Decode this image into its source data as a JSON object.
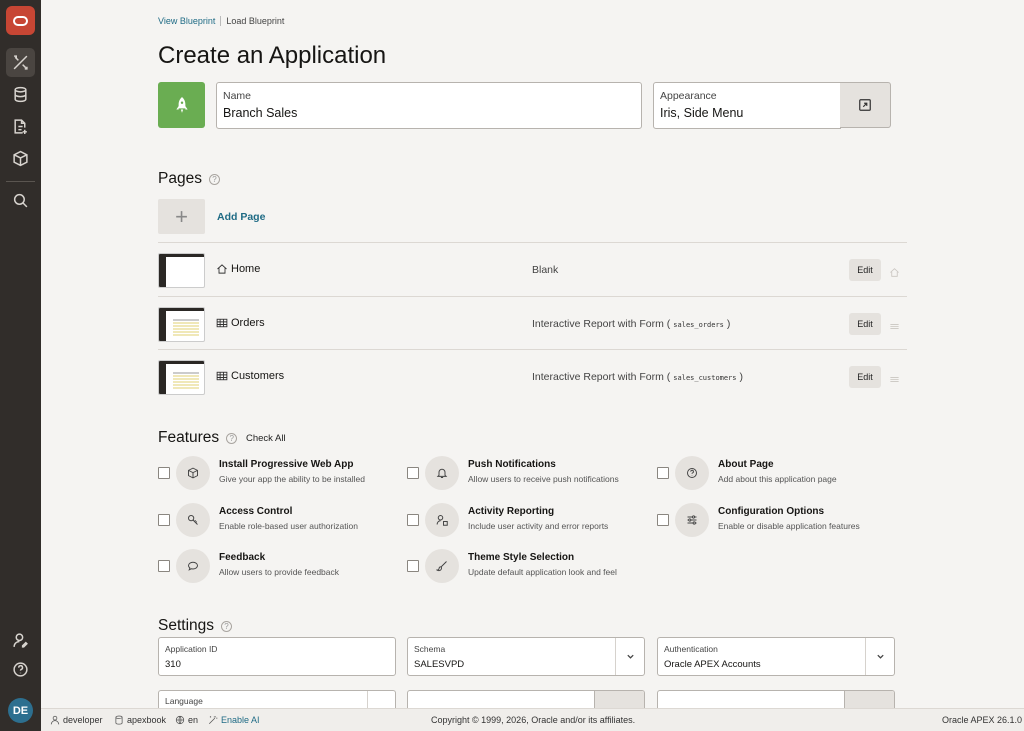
{
  "nav": {
    "items": [
      "builder-icon",
      "database-icon",
      "page-edit-icon",
      "package-icon",
      "search-icon"
    ],
    "bottom_items": [
      "user-settings-icon",
      "help-icon"
    ],
    "avatar_initials": "DE"
  },
  "breadcrumb": {
    "blueprint": "View Blueprint",
    "load": "Load Blueprint"
  },
  "page_title": "Create an Application",
  "name_field": {
    "label": "Name",
    "value": "Branch Sales"
  },
  "appearance_field": {
    "label": "Appearance",
    "value": "Iris, Side Menu"
  },
  "pages_section": {
    "title": "Pages",
    "add_label": "Add Page",
    "rows": [
      {
        "name": "Home",
        "type": "Blank",
        "table": "",
        "edit": "Edit",
        "icon": "home-icon"
      },
      {
        "name": "Orders",
        "type": "Interactive Report with Form (",
        "table": "sales_orders",
        "close": ")",
        "edit": "Edit",
        "icon": "table-icon"
      },
      {
        "name": "Customers",
        "type": "Interactive Report with Form (",
        "table": "sales_customers",
        "close": ")",
        "edit": "Edit",
        "icon": "table-icon"
      }
    ]
  },
  "features_section": {
    "title": "Features",
    "check_all": "Check All",
    "items": [
      {
        "title": "Install Progressive Web App",
        "desc": "Give your app the ability to be installed"
      },
      {
        "title": "Push Notifications",
        "desc": "Allow users to receive push notifications"
      },
      {
        "title": "About Page",
        "desc": "Add about this application page"
      },
      {
        "title": "Access Control",
        "desc": "Enable role-based user authorization"
      },
      {
        "title": "Activity Reporting",
        "desc": "Include user activity and error reports"
      },
      {
        "title": "Configuration Options",
        "desc": "Enable or disable application features"
      },
      {
        "title": "Feedback",
        "desc": "Allow users to provide feedback"
      },
      {
        "title": "Theme Style Selection",
        "desc": "Update default application look and feel"
      }
    ]
  },
  "settings_section": {
    "title": "Settings",
    "application_id": {
      "label": "Application ID",
      "value": "310"
    },
    "schema": {
      "label": "Schema",
      "value": "SALESVPD"
    },
    "authentication": {
      "label": "Authentication",
      "value": "Oracle APEX Accounts"
    },
    "language": {
      "label": "Language",
      "value": ""
    }
  },
  "footer": {
    "user": "developer",
    "workspace": "apexbook",
    "lang": "en",
    "ai": "Enable AI",
    "copyright": "Copyright © 1999, 2026, Oracle and/or its affiliates.",
    "version": "Oracle APEX 26.1.0"
  },
  "colors": {
    "brand": "#c74634",
    "accent": "#1f6b85",
    "sidebar": "#312d2a",
    "app_icon": "#6aad52"
  }
}
